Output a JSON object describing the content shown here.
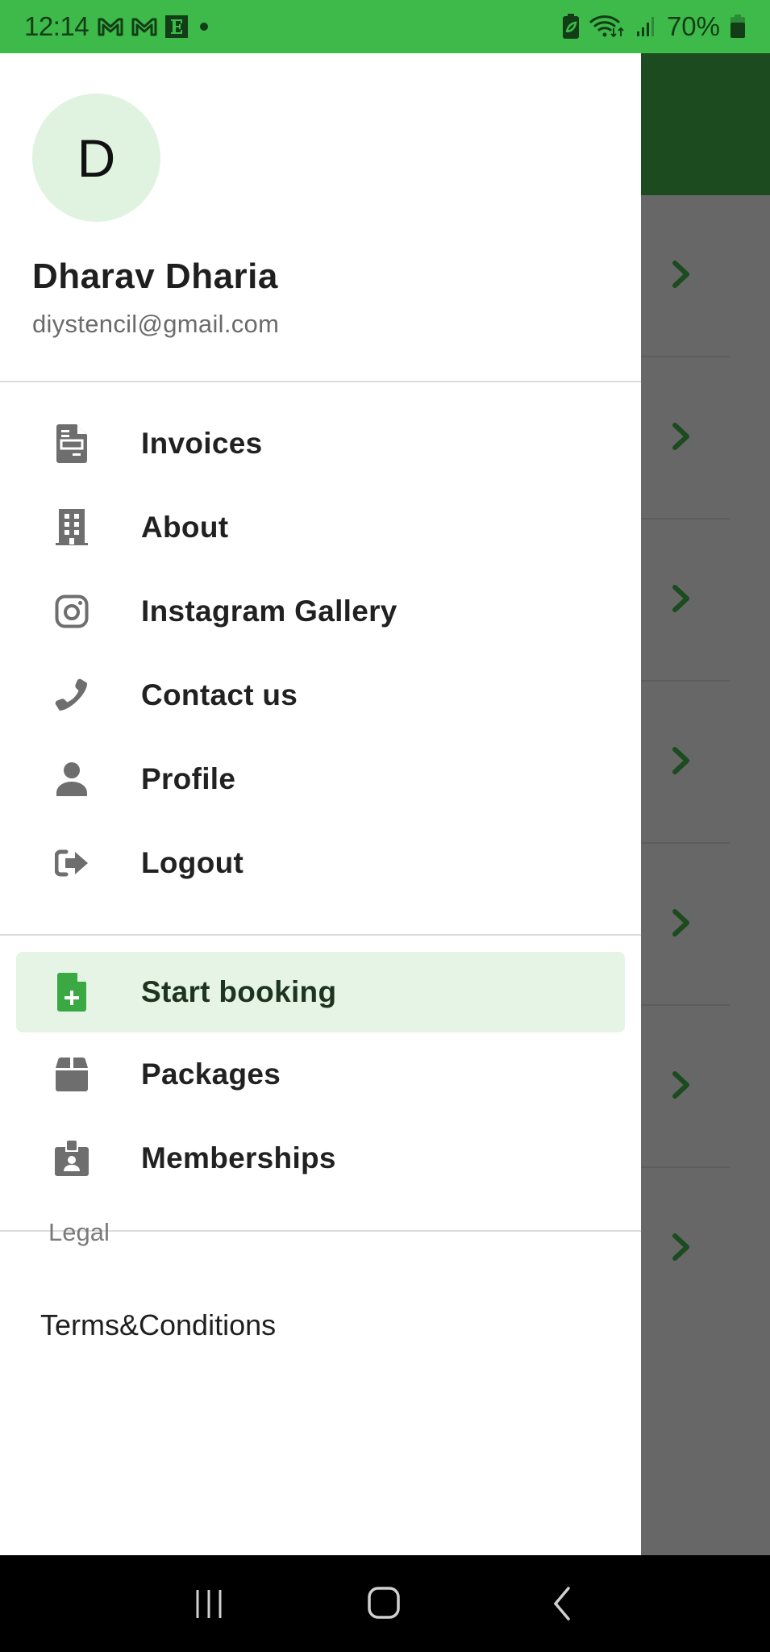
{
  "status_bar": {
    "time": "12:14",
    "notifications": [
      "gmail-icon",
      "gmail-icon",
      "e-app-icon",
      "dot-icon"
    ],
    "battery_percent": "70%",
    "indicators": [
      "battery-saver-icon",
      "wifi-icon",
      "signal-icon",
      "battery-icon"
    ]
  },
  "drawer": {
    "header": {
      "avatar_initial": "D",
      "name": "Dharav Dharia",
      "email": "diystencil@gmail.com"
    },
    "primary_items": [
      {
        "label": "Invoices",
        "icon": "invoice-icon"
      },
      {
        "label": "About",
        "icon": "building-icon"
      },
      {
        "label": "Instagram Gallery",
        "icon": "instagram-icon"
      },
      {
        "label": "Contact us",
        "icon": "phone-icon"
      },
      {
        "label": "Profile",
        "icon": "person-icon"
      },
      {
        "label": "Logout",
        "icon": "logout-icon"
      }
    ],
    "secondary_items": [
      {
        "label": "Start booking",
        "icon": "add-document-icon",
        "active": true
      },
      {
        "label": "Packages",
        "icon": "package-icon",
        "active": false
      },
      {
        "label": "Memberships",
        "icon": "badge-icon",
        "active": false
      }
    ],
    "legal": {
      "title": "Legal",
      "terms_label": "Terms&Conditions"
    }
  },
  "background_list": {
    "row_count": 7,
    "row_icon": "chevron-right-icon"
  },
  "colors": {
    "status_bar": "#3dba49",
    "app_bar": "#1c4b1f",
    "active_bg": "#e6f4e6",
    "active_icon": "#3aa843",
    "icon_gray": "#6e6e6e",
    "avatar_bg": "#e0f3e0",
    "scrim": "#676767"
  }
}
